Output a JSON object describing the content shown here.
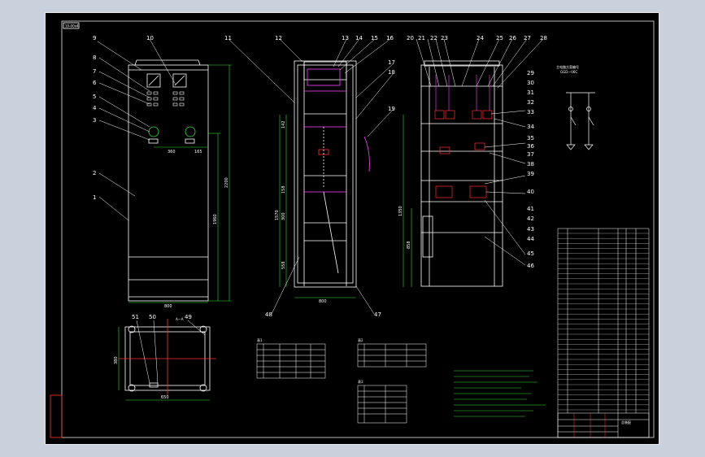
{
  "sheet": {
    "tag": "10-00x4",
    "frame_color": "#e6e6e6",
    "line_color": "#ffffff",
    "accent_green": "#33dd33",
    "accent_red": "#ff3030",
    "accent_magenta": "#ff44ff"
  },
  "callouts_front": [
    "9",
    "10",
    "8",
    "7",
    "6",
    "5",
    "4",
    "3",
    "2",
    "1"
  ],
  "callouts_middle_top": [
    "11",
    "12",
    "13",
    "14",
    "15",
    "16",
    "17",
    "18",
    "19"
  ],
  "callouts_right_top": [
    "20",
    "21",
    "22",
    "23",
    "24",
    "25",
    "26",
    "27",
    "28"
  ],
  "callouts_right_side": [
    "29",
    "30",
    "31",
    "32",
    "33",
    "34",
    "35",
    "36",
    "37",
    "38",
    "39",
    "40",
    "41",
    "42",
    "43",
    "44",
    "45",
    "46"
  ],
  "callouts_bottom": [
    "48",
    "47"
  ],
  "callouts_plan": [
    "51",
    "50",
    "49"
  ],
  "dimensions": {
    "front_width": "800",
    "front_h1": "2200",
    "front_h2": "1960",
    "front_inner_a": "360",
    "front_inner_b": "165",
    "middle_width": "800",
    "middle_h1": "1570",
    "middle_h2": "558",
    "middle_s1": "142",
    "middle_s2": "158",
    "middle_s3": "300",
    "right_h1": "1350",
    "right_h2": "858",
    "plan_width": "650",
    "plan_depth": "380",
    "plan_section": "A—A"
  },
  "wiring_diagram": {
    "title": "主电路方案编号",
    "code": "GGD—06C"
  },
  "table_labels": [
    "表1",
    "表2",
    "表3"
  ],
  "title_block": {
    "stamp": "总装配"
  }
}
